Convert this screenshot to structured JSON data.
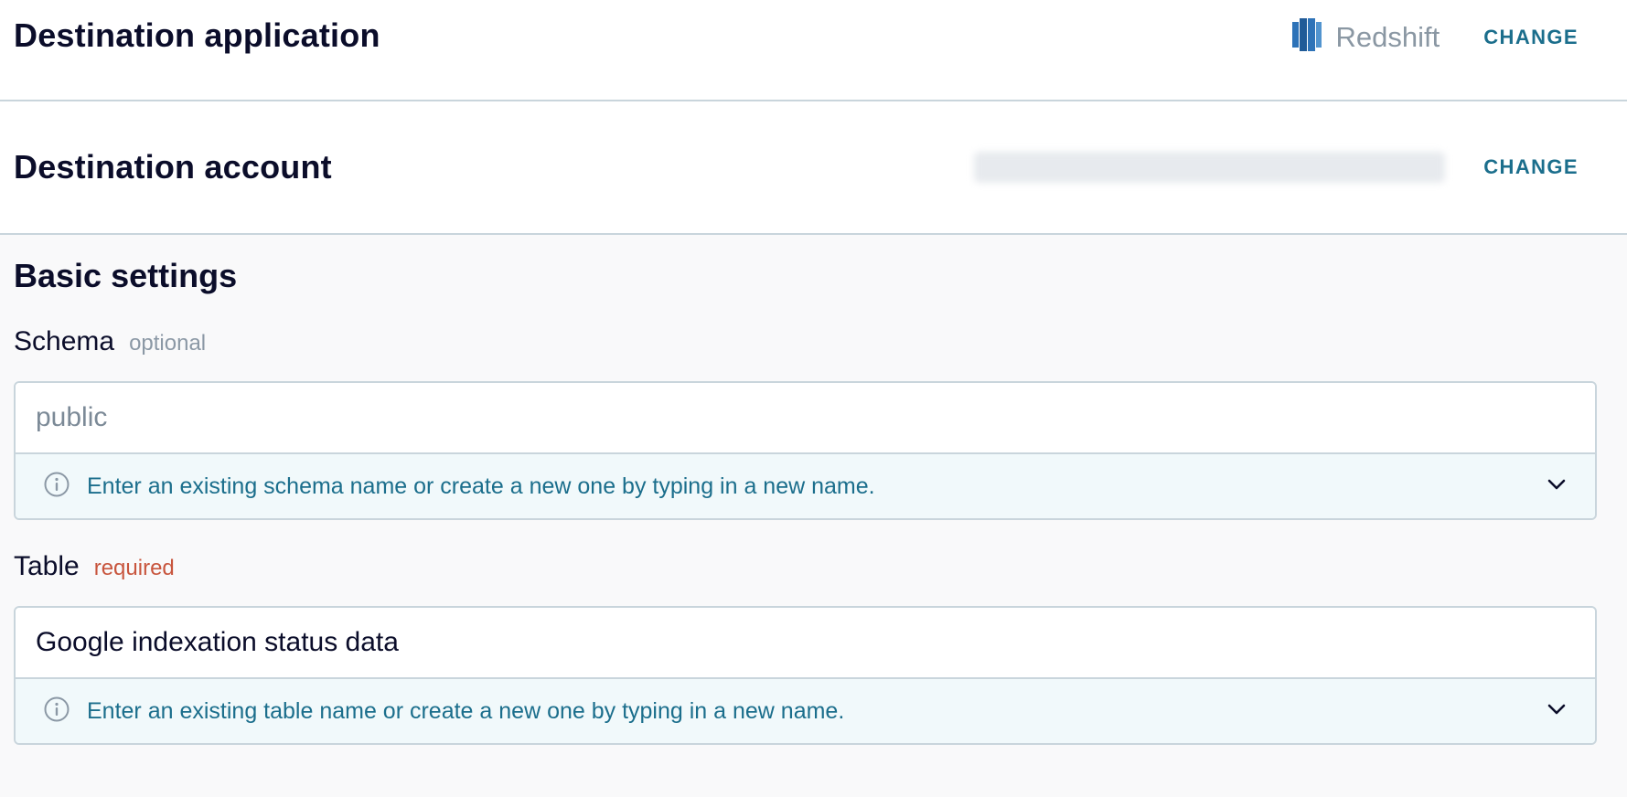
{
  "destination_application": {
    "title": "Destination application",
    "app_name": "Redshift",
    "app_icon": "redshift-logo-icon",
    "change_label": "CHANGE"
  },
  "destination_account": {
    "title": "Destination account",
    "account_value_redacted": true,
    "change_label": "CHANGE"
  },
  "basic_settings": {
    "title": "Basic settings",
    "schema": {
      "label": "Schema",
      "hint": "optional",
      "value": "",
      "placeholder": "public",
      "help_text": "Enter an existing schema name or create a new one by typing in a new name."
    },
    "table": {
      "label": "Table",
      "hint": "required",
      "value": "Google indexation status data",
      "help_text": "Enter an existing table name or create a new one by typing in a new name."
    }
  },
  "colors": {
    "accent": "#1b6e8c",
    "required": "#c8553d",
    "heading": "#0b0d2a",
    "border": "#c9d5dc",
    "help_bg": "#f1f9fb"
  }
}
